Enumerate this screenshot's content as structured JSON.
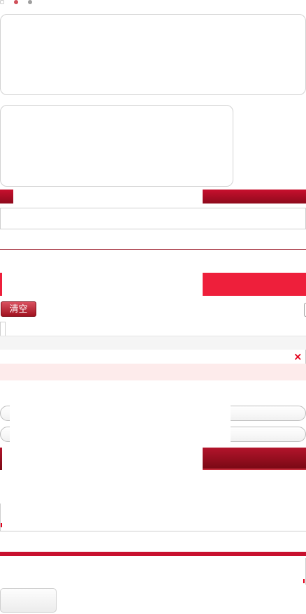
{
  "toolbar": {
    "clear_label": "清空",
    "close_symbol": "×"
  },
  "colors": {
    "accent_red": "#c8102e",
    "accent_red_dark": "#8e0a1c",
    "bright_red": "#ee1f3b",
    "light_pink": "#fdebeb",
    "light_gray": "#f5f5f5"
  }
}
